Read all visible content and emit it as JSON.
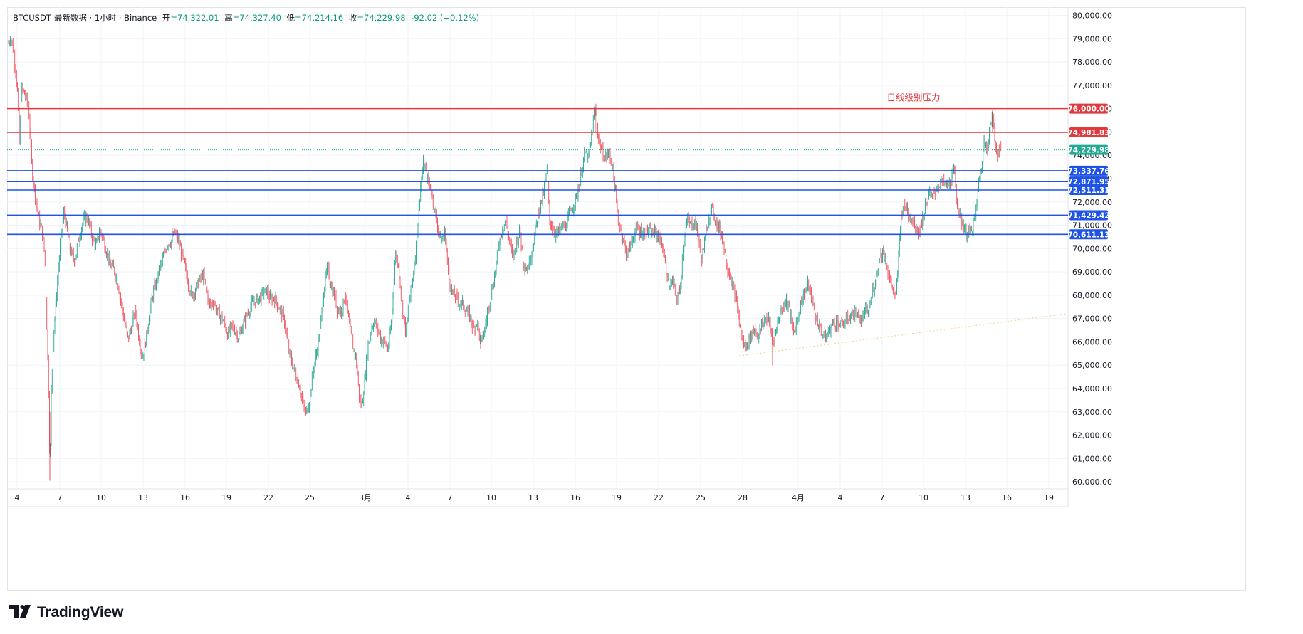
{
  "legend": {
    "symbol": "BTCUSDT",
    "source": "最新数据 · 1小时 · Binance",
    "open_label": "开",
    "open": "=74,322.01",
    "high_label": "高",
    "high": "=74,327.40",
    "low_label": "低",
    "low": "=74,214.16",
    "close_label": "收",
    "close": "=74,229.98",
    "change": "-92.02 (−0.12%)"
  },
  "branding": {
    "name": "TradingView",
    "icon": "tradingview-logo-icon"
  },
  "colors": {
    "up": "#089981",
    "down": "#f23645",
    "resistance": "#e0393e",
    "support": "#1e53e5",
    "last_price": "#22ab94",
    "grid": "#f0f3fa",
    "trend": "#f7d48a"
  },
  "chart_data": {
    "type": "candlestick",
    "ylim": [
      59700,
      80350
    ],
    "y_ticks": [
      "60,000.00",
      "61,000.00",
      "62,000.00",
      "63,000.00",
      "64,000.00",
      "65,000.00",
      "66,000.00",
      "67,000.00",
      "68,000.00",
      "69,000.00",
      "70,000.00",
      "71,000.00",
      "72,000.00",
      "73,000.00",
      "74,000.00",
      "75,000.00",
      "76,000.00",
      "77,000.00",
      "78,000.00",
      "79,000.00",
      "80,000.00"
    ],
    "x_ticks": [
      "4",
      "7",
      "10",
      "13",
      "16",
      "19",
      "22",
      "25",
      "3月",
      "4",
      "7",
      "10",
      "13",
      "16",
      "19",
      "22",
      "25",
      "28",
      "4月",
      "4",
      "7",
      "10",
      "13",
      "16",
      "19"
    ],
    "horizontal_levels": [
      {
        "label": "76,000.00",
        "value": 76000,
        "kind": "resistance"
      },
      {
        "label": "74,981.83",
        "value": 74981.83,
        "kind": "resistance"
      },
      {
        "label": "73,337.76",
        "value": 73337.76,
        "kind": "support"
      },
      {
        "label": "72,871.95",
        "value": 72871.95,
        "kind": "support"
      },
      {
        "label": "72,511.31",
        "value": 72511.31,
        "kind": "support"
      },
      {
        "label": "71,429.42",
        "value": 71429.42,
        "kind": "support"
      },
      {
        "label": "70,611.13",
        "value": 70611.13,
        "kind": "support"
      }
    ],
    "last_price": {
      "label": "74,229.98",
      "value": 74229.98
    },
    "annotation": {
      "text": "日线级别压力",
      "value": 76000
    },
    "trend_line": [
      {
        "x": 1038,
        "y": 65400
      },
      {
        "x": 1497,
        "y": 67200
      }
    ],
    "price_path": [
      [
        12,
        78800
      ],
      [
        15,
        79100
      ],
      [
        18,
        78600
      ],
      [
        22,
        77700
      ],
      [
        25,
        76500
      ],
      [
        27,
        74500
      ],
      [
        30,
        76900
      ],
      [
        35,
        76600
      ],
      [
        40,
        76100
      ],
      [
        45,
        73400
      ],
      [
        50,
        72100
      ],
      [
        55,
        71200
      ],
      [
        60,
        70600
      ],
      [
        63,
        69600
      ],
      [
        66,
        66400
      ],
      [
        69,
        63000
      ],
      [
        70,
        60050
      ],
      [
        72,
        63900
      ],
      [
        75,
        66300
      ],
      [
        78,
        67400
      ],
      [
        82,
        69200
      ],
      [
        86,
        70600
      ],
      [
        90,
        71600
      ],
      [
        95,
        70600
      ],
      [
        100,
        69800
      ],
      [
        105,
        69500
      ],
      [
        110,
        70300
      ],
      [
        115,
        71000
      ],
      [
        120,
        71400
      ],
      [
        125,
        71100
      ],
      [
        130,
        70400
      ],
      [
        135,
        70100
      ],
      [
        140,
        70800
      ],
      [
        145,
        70400
      ],
      [
        150,
        69800
      ],
      [
        155,
        69300
      ],
      [
        160,
        69100
      ],
      [
        165,
        68600
      ],
      [
        170,
        67700
      ],
      [
        175,
        66800
      ],
      [
        180,
        66100
      ],
      [
        185,
        66700
      ],
      [
        190,
        67400
      ],
      [
        195,
        66200
      ],
      [
        200,
        65300
      ],
      [
        205,
        66100
      ],
      [
        210,
        67300
      ],
      [
        215,
        68100
      ],
      [
        220,
        68600
      ],
      [
        225,
        69200
      ],
      [
        230,
        69700
      ],
      [
        235,
        70200
      ],
      [
        240,
        70300
      ],
      [
        245,
        70700
      ],
      [
        250,
        70400
      ],
      [
        255,
        69800
      ],
      [
        260,
        69200
      ],
      [
        265,
        68400
      ],
      [
        270,
        68000
      ],
      [
        275,
        68300
      ],
      [
        280,
        68600
      ],
      [
        285,
        68900
      ],
      [
        290,
        68200
      ],
      [
        295,
        67500
      ],
      [
        300,
        67800
      ],
      [
        305,
        67300
      ],
      [
        310,
        67100
      ],
      [
        315,
        66800
      ],
      [
        320,
        66300
      ],
      [
        325,
        66700
      ],
      [
        330,
        66500
      ],
      [
        335,
        66200
      ],
      [
        340,
        66600
      ],
      [
        345,
        67000
      ],
      [
        350,
        67400
      ],
      [
        355,
        67700
      ],
      [
        360,
        67800
      ],
      [
        365,
        67900
      ],
      [
        370,
        68100
      ],
      [
        375,
        68200
      ],
      [
        380,
        67800
      ],
      [
        385,
        67900
      ],
      [
        390,
        67600
      ],
      [
        395,
        67300
      ],
      [
        400,
        66800
      ],
      [
        405,
        65700
      ],
      [
        410,
        65100
      ],
      [
        415,
        64600
      ],
      [
        420,
        64200
      ],
      [
        425,
        63400
      ],
      [
        430,
        62900
      ],
      [
        435,
        63600
      ],
      [
        440,
        64800
      ],
      [
        445,
        65600
      ],
      [
        450,
        66700
      ],
      [
        455,
        68300
      ],
      [
        460,
        69200
      ],
      [
        465,
        68400
      ],
      [
        470,
        67900
      ],
      [
        475,
        67400
      ],
      [
        480,
        67300
      ],
      [
        485,
        68100
      ],
      [
        490,
        66800
      ],
      [
        495,
        65900
      ],
      [
        500,
        65300
      ],
      [
        505,
        63500
      ],
      [
        508,
        63200
      ],
      [
        512,
        64300
      ],
      [
        516,
        65700
      ],
      [
        520,
        66400
      ],
      [
        525,
        66900
      ],
      [
        530,
        66600
      ],
      [
        535,
        66100
      ],
      [
        540,
        66000
      ],
      [
        545,
        65700
      ],
      [
        550,
        66900
      ],
      [
        555,
        69800
      ],
      [
        560,
        69200
      ],
      [
        565,
        67500
      ],
      [
        570,
        66400
      ],
      [
        575,
        67800
      ],
      [
        580,
        68800
      ],
      [
        585,
        70300
      ],
      [
        590,
        72500
      ],
      [
        595,
        73700
      ],
      [
        600,
        73000
      ],
      [
        605,
        72600
      ],
      [
        610,
        71700
      ],
      [
        615,
        70900
      ],
      [
        620,
        70300
      ],
      [
        625,
        70700
      ],
      [
        630,
        68800
      ],
      [
        635,
        68100
      ],
      [
        640,
        67900
      ],
      [
        645,
        67700
      ],
      [
        650,
        67600
      ],
      [
        655,
        67300
      ],
      [
        660,
        67100
      ],
      [
        665,
        66500
      ],
      [
        670,
        66900
      ],
      [
        675,
        65900
      ],
      [
        680,
        66400
      ],
      [
        685,
        67300
      ],
      [
        690,
        68100
      ],
      [
        695,
        68900
      ],
      [
        700,
        70100
      ],
      [
        705,
        70800
      ],
      [
        710,
        71200
      ],
      [
        715,
        70400
      ],
      [
        720,
        69600
      ],
      [
        725,
        70200
      ],
      [
        730,
        70800
      ],
      [
        735,
        69400
      ],
      [
        740,
        69100
      ],
      [
        745,
        69600
      ],
      [
        750,
        70400
      ],
      [
        755,
        71400
      ],
      [
        760,
        72000
      ],
      [
        765,
        72600
      ],
      [
        768,
        73500
      ],
      [
        772,
        71200
      ],
      [
        776,
        70900
      ],
      [
        780,
        70600
      ],
      [
        785,
        70700
      ],
      [
        790,
        70900
      ],
      [
        795,
        71000
      ],
      [
        800,
        71500
      ],
      [
        805,
        71800
      ],
      [
        810,
        72300
      ],
      [
        815,
        72900
      ],
      [
        818,
        73600
      ],
      [
        822,
        74100
      ],
      [
        826,
        73800
      ],
      [
        830,
        74600
      ],
      [
        834,
        75700
      ],
      [
        836,
        76000
      ],
      [
        840,
        74800
      ],
      [
        845,
        74200
      ],
      [
        850,
        73900
      ],
      [
        855,
        74100
      ],
      [
        860,
        73600
      ],
      [
        864,
        72500
      ],
      [
        868,
        71200
      ],
      [
        872,
        70800
      ],
      [
        876,
        70300
      ],
      [
        880,
        69700
      ],
      [
        885,
        70100
      ],
      [
        890,
        70600
      ],
      [
        895,
        70900
      ],
      [
        900,
        70700
      ],
      [
        905,
        70700
      ],
      [
        910,
        70800
      ],
      [
        915,
        70600
      ],
      [
        920,
        70700
      ],
      [
        925,
        70500
      ],
      [
        930,
        70200
      ],
      [
        935,
        69200
      ],
      [
        940,
        68300
      ],
      [
        945,
        68600
      ],
      [
        950,
        67800
      ],
      [
        955,
        68200
      ],
      [
        960,
        70300
      ],
      [
        965,
        71200
      ],
      [
        970,
        71000
      ],
      [
        975,
        71200
      ],
      [
        980,
        70700
      ],
      [
        985,
        69500
      ],
      [
        990,
        70300
      ],
      [
        995,
        71300
      ],
      [
        1000,
        71700
      ],
      [
        1005,
        71200
      ],
      [
        1010,
        70900
      ],
      [
        1015,
        70400
      ],
      [
        1020,
        69400
      ],
      [
        1025,
        68900
      ],
      [
        1030,
        68300
      ],
      [
        1035,
        67600
      ],
      [
        1040,
        66400
      ],
      [
        1045,
        65800
      ],
      [
        1050,
        65900
      ],
      [
        1055,
        66300
      ],
      [
        1060,
        66600
      ],
      [
        1065,
        66200
      ],
      [
        1070,
        66700
      ],
      [
        1075,
        67000
      ],
      [
        1080,
        66900
      ],
      [
        1085,
        66000
      ],
      [
        1090,
        66500
      ],
      [
        1095,
        67200
      ],
      [
        1100,
        67600
      ],
      [
        1105,
        67800
      ],
      [
        1110,
        67100
      ],
      [
        1115,
        66400
      ],
      [
        1120,
        67000
      ],
      [
        1125,
        67700
      ],
      [
        1130,
        68100
      ],
      [
        1135,
        68500
      ],
      [
        1140,
        67800
      ],
      [
        1145,
        67100
      ],
      [
        1150,
        66700
      ],
      [
        1155,
        66300
      ],
      [
        1160,
        66200
      ],
      [
        1165,
        66500
      ],
      [
        1170,
        66800
      ],
      [
        1175,
        66900
      ],
      [
        1180,
        66700
      ],
      [
        1185,
        66800
      ],
      [
        1190,
        67000
      ],
      [
        1195,
        67100
      ],
      [
        1200,
        67200
      ],
      [
        1205,
        67100
      ],
      [
        1210,
        66900
      ],
      [
        1215,
        67300
      ],
      [
        1220,
        67300
      ],
      [
        1225,
        68100
      ],
      [
        1230,
        68700
      ],
      [
        1235,
        69600
      ],
      [
        1240,
        69900
      ],
      [
        1245,
        69300
      ],
      [
        1250,
        68600
      ],
      [
        1255,
        68200
      ],
      [
        1258,
        67800
      ],
      [
        1262,
        69600
      ],
      [
        1265,
        71400
      ],
      [
        1268,
        71700
      ],
      [
        1272,
        71800
      ],
      [
        1276,
        71500
      ],
      [
        1280,
        71300
      ],
      [
        1285,
        71000
      ],
      [
        1290,
        70700
      ],
      [
        1295,
        71100
      ],
      [
        1300,
        71900
      ],
      [
        1305,
        72300
      ],
      [
        1310,
        72200
      ],
      [
        1315,
        72600
      ],
      [
        1320,
        72800
      ],
      [
        1325,
        72900
      ],
      [
        1330,
        72700
      ],
      [
        1335,
        72900
      ],
      [
        1340,
        73400
      ],
      [
        1344,
        72000
      ],
      [
        1348,
        71300
      ],
      [
        1352,
        71100
      ],
      [
        1356,
        70700
      ],
      [
        1360,
        70600
      ],
      [
        1365,
        70900
      ],
      [
        1370,
        71400
      ],
      [
        1374,
        72700
      ],
      [
        1378,
        73400
      ],
      [
        1382,
        74600
      ],
      [
        1386,
        74400
      ],
      [
        1390,
        75100
      ],
      [
        1394,
        75800
      ],
      [
        1397,
        74700
      ],
      [
        1400,
        74100
      ],
      [
        1404,
        74300
      ],
      [
        1406,
        74230
      ]
    ]
  }
}
